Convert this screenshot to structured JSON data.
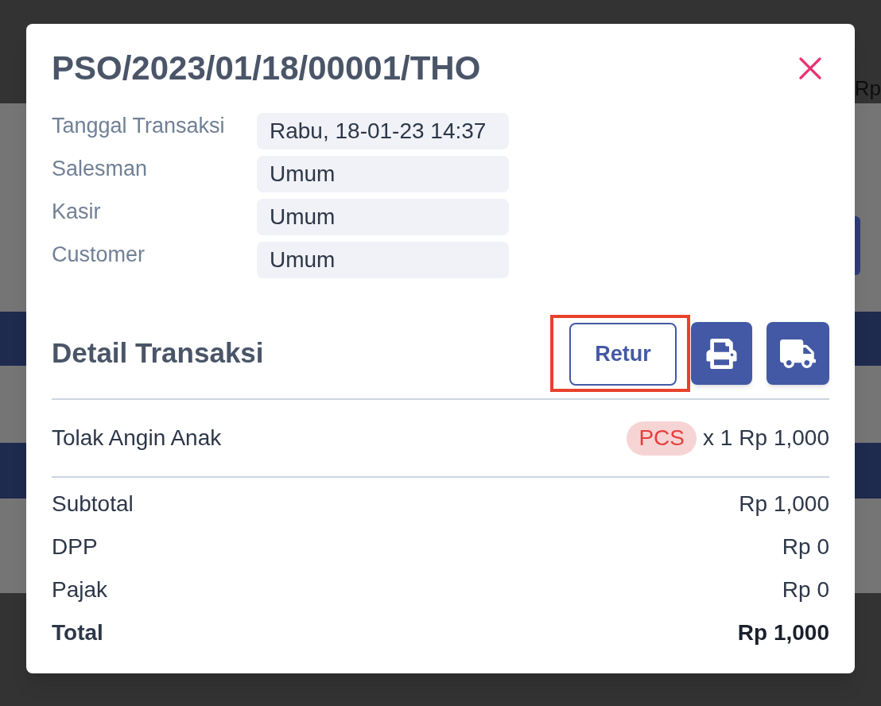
{
  "background": {
    "header_text": "Rp"
  },
  "modal": {
    "title": "PSO/2023/01/18/00001/THO",
    "info": [
      {
        "label": "Tanggal Transaksi",
        "value": "Rabu, 18-01-23 14:37"
      },
      {
        "label": "Salesman",
        "value": "Umum"
      },
      {
        "label": "Kasir",
        "value": "Umum"
      },
      {
        "label": "Customer",
        "value": "Umum"
      }
    ],
    "detail": {
      "heading": "Detail Transaksi",
      "actions": [
        {
          "kind": "text",
          "label": "Retur",
          "highlighted": true
        },
        {
          "kind": "print",
          "highlighted": false
        },
        {
          "kind": "delivery",
          "highlighted": false
        }
      ],
      "items": [
        {
          "name": "Tolak Angin Anak",
          "unit": "PCS",
          "quantity": "x 1",
          "price": "Rp 1,000"
        }
      ],
      "summary": [
        {
          "label": "Subtotal",
          "value": "Rp 1,000",
          "bold": false
        },
        {
          "label": "DPP",
          "value": "Rp 0",
          "bold": false
        },
        {
          "label": "Pajak",
          "value": "Rp 0",
          "bold": false
        },
        {
          "label": "Total",
          "value": "Rp 1,000",
          "bold": true
        }
      ]
    }
  }
}
